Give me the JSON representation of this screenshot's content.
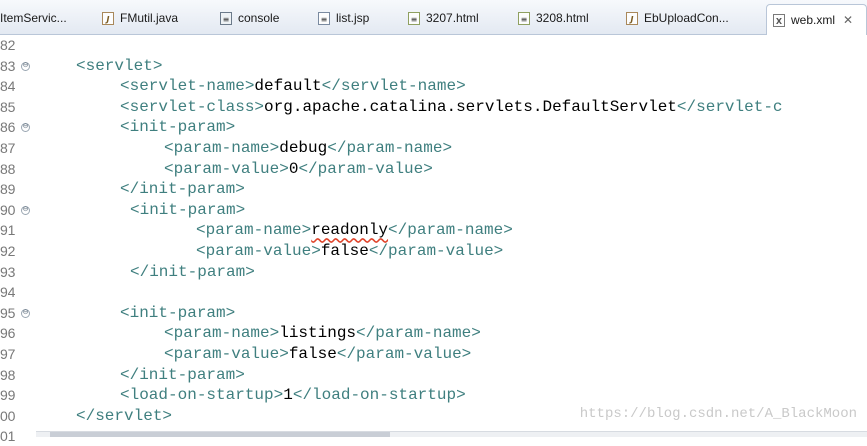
{
  "tabs": [
    {
      "label": "ItemServic...",
      "icon": "java-file-icon",
      "glyph": "J"
    },
    {
      "label": "FMutil.java",
      "icon": "java-file-icon",
      "glyph": "J"
    },
    {
      "label": "console",
      "icon": "console-file-icon",
      "glyph": "≡"
    },
    {
      "label": "list.jsp",
      "icon": "jsp-file-icon",
      "glyph": "≡"
    },
    {
      "label": "3207.html",
      "icon": "html-file-icon",
      "glyph": "≡"
    },
    {
      "label": "3208.html",
      "icon": "html-file-icon",
      "glyph": "≡"
    },
    {
      "label": "EbUploadCon...",
      "icon": "java-file-icon",
      "glyph": "J"
    },
    {
      "label": "web.xml",
      "icon": "xml-file-icon",
      "glyph": "X",
      "active": true,
      "close": "✕"
    }
  ],
  "lines": [
    {
      "num": "82",
      "parts": []
    },
    {
      "num": "83",
      "fold": "⊖",
      "parts": [
        [
          "tag",
          "<servlet>"
        ]
      ]
    },
    {
      "num": "84",
      "parts": [
        [
          "tag",
          "<servlet-name>"
        ],
        [
          "txt",
          "default"
        ],
        [
          "tag",
          "</servlet-name>"
        ]
      ]
    },
    {
      "num": "85",
      "parts": [
        [
          "tag",
          "<servlet-class>"
        ],
        [
          "txt",
          "org.apache.catalina.servlets.DefaultServlet"
        ],
        [
          "tag",
          "</servlet-c"
        ]
      ]
    },
    {
      "num": "86",
      "fold": "⊖",
      "parts": [
        [
          "tag",
          "<init-param>"
        ]
      ]
    },
    {
      "num": "87",
      "parts": [
        [
          "tag",
          "<param-name>"
        ],
        [
          "txt",
          "debug"
        ],
        [
          "tag",
          "</param-name>"
        ]
      ]
    },
    {
      "num": "88",
      "parts": [
        [
          "tag",
          "<param-value>"
        ],
        [
          "txt",
          "0"
        ],
        [
          "tag",
          "</param-value>"
        ]
      ]
    },
    {
      "num": "89",
      "parts": [
        [
          "tag",
          "</init-param>"
        ]
      ]
    },
    {
      "num": "90",
      "fold": "⊖",
      "parts": [
        [
          "tag",
          "<init-param>"
        ]
      ]
    },
    {
      "num": "91",
      "parts": [
        [
          "tag",
          "<param-name>"
        ],
        [
          "spell",
          "readonly"
        ],
        [
          "tag",
          "</param-name>"
        ]
      ]
    },
    {
      "num": "92",
      "parts": [
        [
          "tag",
          "<param-value>"
        ],
        [
          "txt",
          "false"
        ],
        [
          "tag",
          "</param-value>"
        ]
      ]
    },
    {
      "num": "93",
      "parts": [
        [
          "tag",
          "</init-param>"
        ]
      ]
    },
    {
      "num": "94",
      "parts": []
    },
    {
      "num": "95",
      "fold": "⊖",
      "parts": [
        [
          "tag",
          "<init-param>"
        ]
      ]
    },
    {
      "num": "96",
      "parts": [
        [
          "tag",
          "<param-name>"
        ],
        [
          "txt",
          "listings"
        ],
        [
          "tag",
          "</param-name>"
        ]
      ]
    },
    {
      "num": "97",
      "parts": [
        [
          "tag",
          "<param-value>"
        ],
        [
          "txt",
          "false"
        ],
        [
          "tag",
          "</param-value>"
        ]
      ]
    },
    {
      "num": "98",
      "parts": [
        [
          "tag",
          "</init-param>"
        ]
      ]
    },
    {
      "num": "99",
      "parts": [
        [
          "tag",
          "<load-on-startup>"
        ],
        [
          "txt",
          "1"
        ],
        [
          "tag",
          "</load-on-startup>"
        ]
      ]
    },
    {
      "num": "00",
      "parts": [
        [
          "tag",
          "</servlet>"
        ]
      ]
    },
    {
      "num": "01",
      "parts": []
    }
  ],
  "watermark": "https://blog.csdn.net/A_BlackMoon",
  "colors": {
    "tag": "#3f7f7f",
    "text": "#000000",
    "spelling": "#e0452c"
  }
}
